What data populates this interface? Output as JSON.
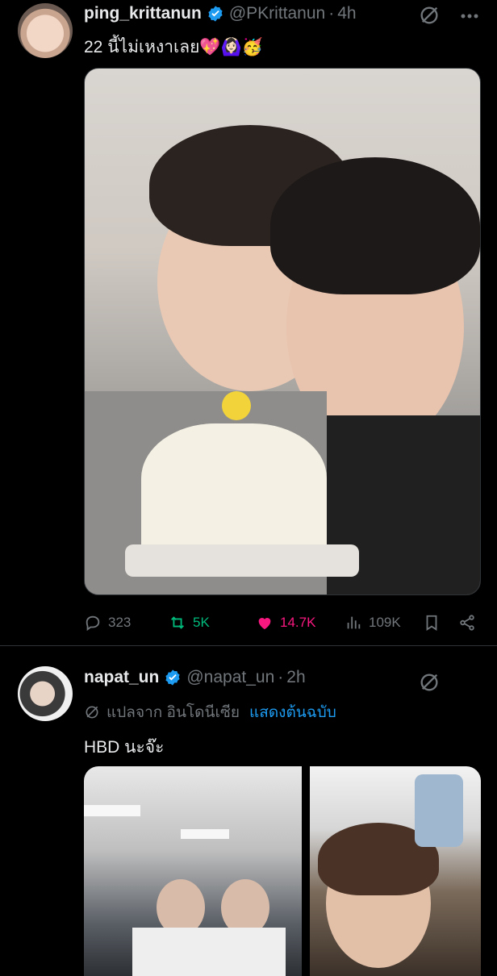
{
  "tweets": [
    {
      "author": {
        "name": "ping_krittanun",
        "handle": "@PKrittanun",
        "time": "4h"
      },
      "separator": "·",
      "text": "22 นี้ไม่เหงาเลย💖🙆🏻‍♀️🥳",
      "stats": {
        "replies": "323",
        "retweets": "5K",
        "likes": "14.7K",
        "views": "109K"
      },
      "liked": true,
      "retweeted": true
    },
    {
      "author": {
        "name": "napat_un",
        "handle": "@napat_un",
        "time": "2h"
      },
      "separator": "·",
      "translation": {
        "label": "แปลจาก อินโดนีเซีย",
        "show_original": "แสดงต้นฉบับ"
      },
      "text": "HBD นะจ๊ะ"
    }
  ],
  "colors": {
    "background": "#000000",
    "text": "#e7e9ea",
    "muted": "#71767b",
    "verified": "#1d9bf0",
    "like": "#f91880",
    "retweet": "#00ba7c",
    "link": "#1d9bf0"
  },
  "icons": {
    "verified": "verified-badge-icon",
    "grok": "grok-icon",
    "more": "more-icon",
    "reply": "reply-icon",
    "retweet": "retweet-icon",
    "like": "heart-icon",
    "views": "views-icon",
    "bookmark": "bookmark-icon",
    "share": "share-icon",
    "translate": "translate-icon"
  }
}
